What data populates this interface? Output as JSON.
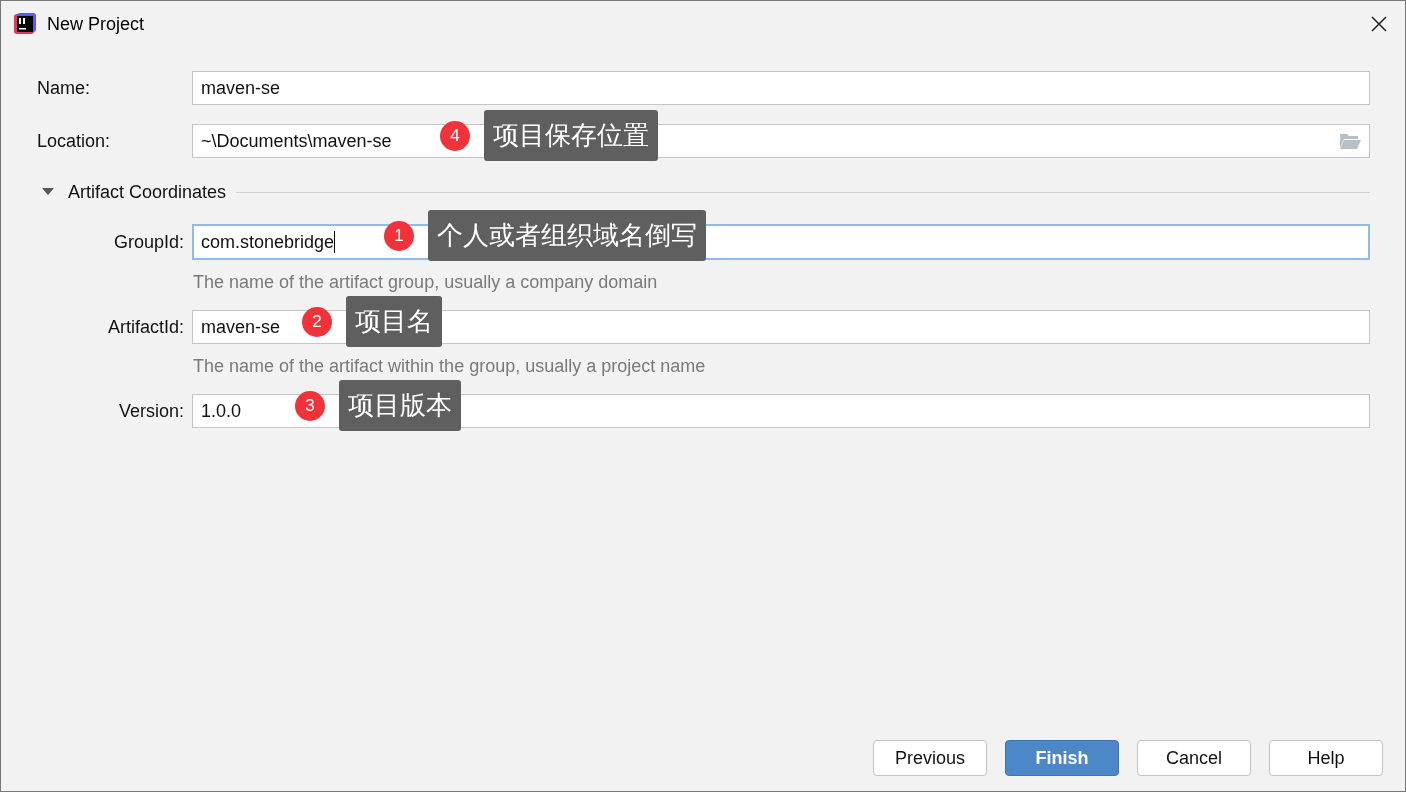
{
  "window": {
    "title": "New Project"
  },
  "fields": [
    {
      "label": "Name:",
      "value": "maven-se",
      "focused": false
    },
    {
      "label": "Location:",
      "value": "~\\Documents\\maven-se",
      "focused": false,
      "browse": true,
      "annotation": {
        "number": "4",
        "text": "项目保存位置"
      }
    }
  ],
  "section": {
    "title": "Artifact Coordinates",
    "expanded": true,
    "fields": [
      {
        "label": "GroupId:",
        "value": "com.stonebridge",
        "focused": true,
        "hint": "The name of the artifact group, usually a company domain",
        "annotation": {
          "number": "1",
          "text": "个人或者组织域名倒写"
        }
      },
      {
        "label": "ArtifactId:",
        "value": "maven-se",
        "focused": false,
        "hint": "The name of the artifact within the group, usually a project name",
        "annotation": {
          "number": "2",
          "text": "项目名"
        }
      },
      {
        "label": "Version:",
        "value": "1.0.0",
        "focused": false,
        "annotation": {
          "number": "3",
          "text": "项目版本"
        }
      }
    ]
  },
  "buttons": [
    {
      "label": "Previous",
      "primary": false
    },
    {
      "label": "Finish",
      "primary": true
    },
    {
      "label": "Cancel",
      "primary": false
    },
    {
      "label": "Help",
      "primary": false
    }
  ]
}
